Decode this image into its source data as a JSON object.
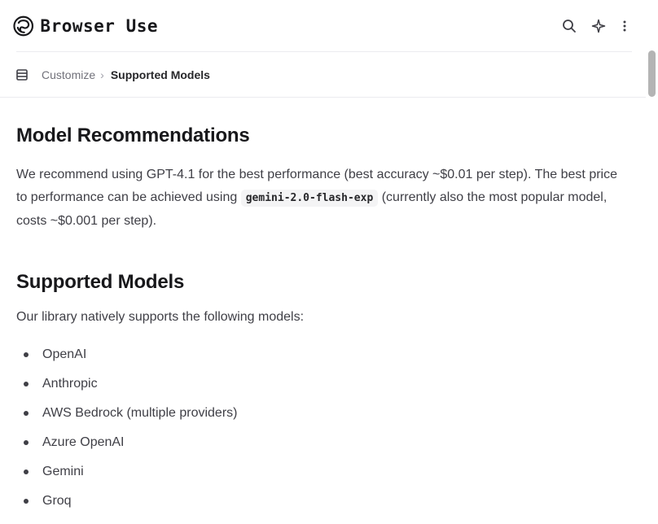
{
  "header": {
    "logo_text": "Browser Use",
    "logo_icon": "browser-use-logo-icon",
    "search_icon": "search-icon",
    "ai_icon": "sparkle-icon",
    "more_icon": "more-vertical-icon"
  },
  "breadcrumb": {
    "parent": "Customize",
    "separator": "›",
    "current": "Supported Models",
    "menu_icon": "menu-icon"
  },
  "content": {
    "section1_title": "Model Recommendations",
    "recommendation_text_1": "We recommend using GPT-4.1 for the best performance (best accuracy ~$0.01 per step). The best price to performance can be achieved using ",
    "recommendation_code": "gemini-2.0-flash-exp",
    "recommendation_text_2": " (currently also the most popular model, costs ~$0.001 per step).",
    "section2_title": "Supported Models",
    "intro": "Our library natively supports the following models:",
    "models": [
      "OpenAI",
      "Anthropic",
      "AWS Bedrock (multiple providers)",
      "Azure OpenAI",
      "Gemini",
      "Groq"
    ]
  },
  "colors": {
    "text": "#3f3f46",
    "heading": "#18181b",
    "code_bg": "#f4f4f5",
    "scrollbar": "#b4b4b4"
  }
}
